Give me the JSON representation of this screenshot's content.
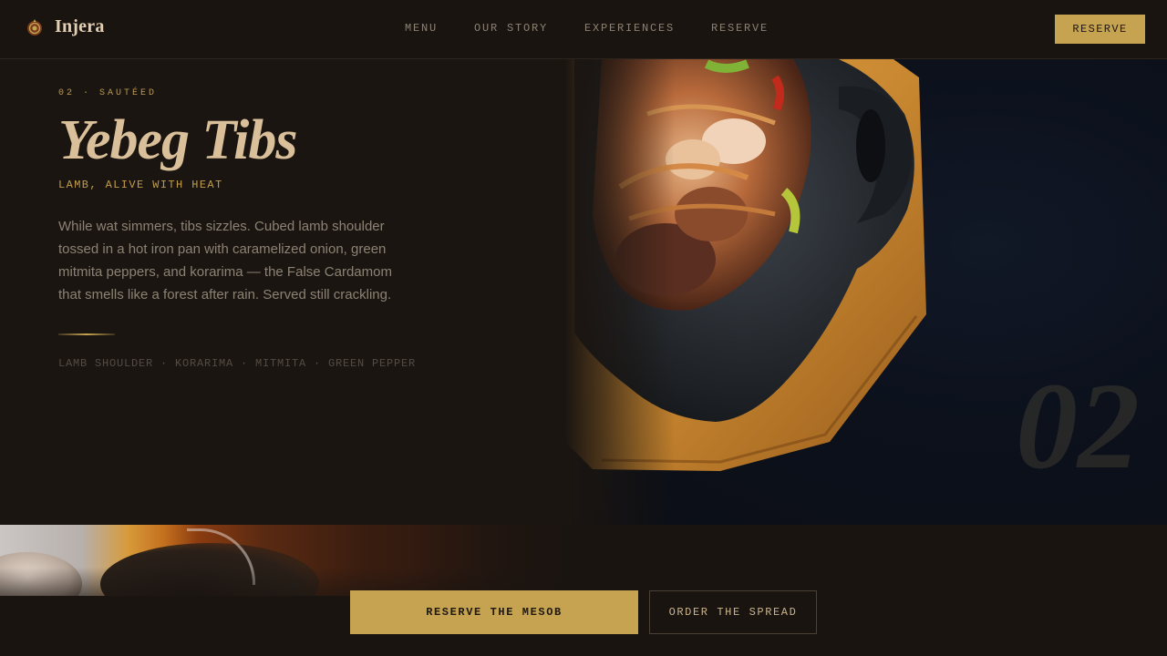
{
  "nav": {
    "brand_name": "Injera",
    "links": [
      "MENU",
      "OUR STORY",
      "EXPERIENCES",
      "RESERVE"
    ],
    "cta_label": "RESERVE"
  },
  "dish": {
    "eyebrow": "02 · SAUTÉED",
    "title": "Yebeg Tibs",
    "subtitle": "LAMB, ALIVE WITH HEAT",
    "description": "While wat simmers, tibs sizzles. Cubed lamb shoulder tossed in a hot iron pan with caramelized onion, green mitmita peppers, and korarima — the False Cardamom that smells like a forest after rain. Served still crackling.",
    "ingredients": "LAMB SHOULDER · KORARIMA · MITMITA · GREEN PEPPER",
    "number": "02"
  },
  "actions": {
    "primary_label": "RESERVE THE MESOB",
    "secondary_label": "ORDER THE SPREAD"
  },
  "colors": {
    "background": "#1b1511",
    "accent_gold": "#c6a350",
    "title": "#d9c09a",
    "body_text": "#8c8274"
  },
  "icons": {
    "brand": "mesob-basket-icon"
  }
}
